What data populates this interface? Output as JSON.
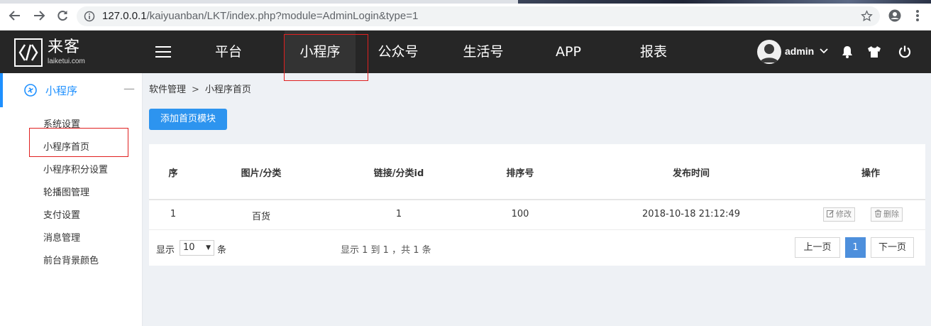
{
  "browser": {
    "url_host": "127.0.0.1",
    "url_path": "/kaiyuanban/LKT/index.php?module=AdminLogin&type=1"
  },
  "header": {
    "logo_text": "来客",
    "logo_sub": "laiketui.com",
    "nav": [
      {
        "label": "平台"
      },
      {
        "label": "小程序"
      },
      {
        "label": "公众号"
      },
      {
        "label": "生活号"
      },
      {
        "label": "APP"
      },
      {
        "label": "报表"
      }
    ],
    "active_nav": "小程序",
    "user_name": "admin"
  },
  "sidebar": {
    "section_label": "小程序",
    "section_toggle": "—",
    "items": [
      {
        "label": "系统设置"
      },
      {
        "label": "小程序首页"
      },
      {
        "label": "小程序积分设置"
      },
      {
        "label": "轮播图管理"
      },
      {
        "label": "支付设置"
      },
      {
        "label": "消息管理"
      },
      {
        "label": "前台背景颜色"
      }
    ]
  },
  "breadcrumb": {
    "parent": "软件管理",
    "separator": ">",
    "current": "小程序首页"
  },
  "add_button_label": "添加首页模块",
  "table": {
    "columns": [
      "序",
      "图片/分类",
      "链接/分类id",
      "排序号",
      "发布时间",
      "操作"
    ],
    "rows": [
      {
        "index": "1",
        "category": "百货",
        "link_id": "1",
        "sort": "100",
        "time": "2018-10-18 21:12:49",
        "edit": "修改",
        "delete": "删除"
      }
    ]
  },
  "pagination": {
    "show_label": "显示",
    "page_size": "10",
    "unit_label": "条",
    "info": "显示 1 到 1 ，共 1 条",
    "prev": "上一页",
    "current": "1",
    "next": "下一页"
  },
  "colors": {
    "accent": "#2d94ef",
    "header_bg": "#262626",
    "highlight": "#e02020"
  }
}
